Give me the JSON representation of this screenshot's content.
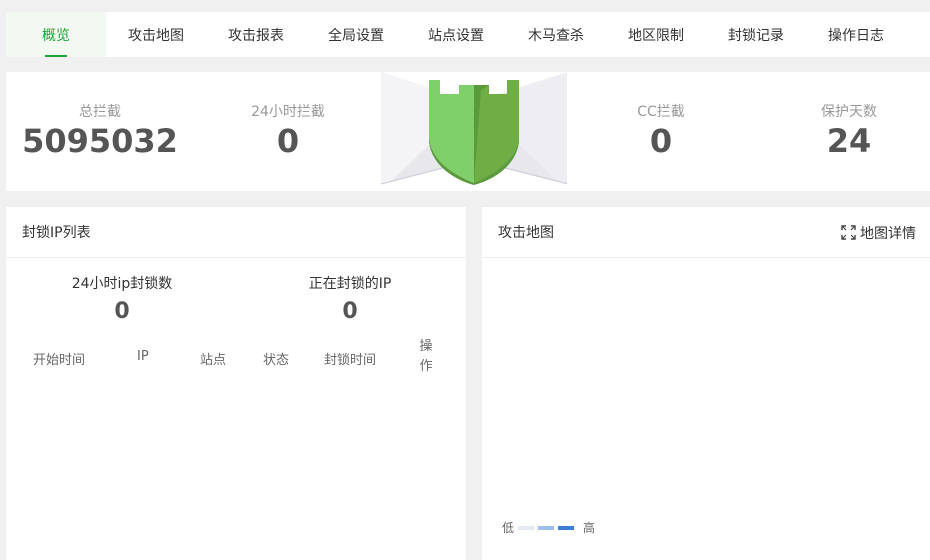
{
  "tabs": [
    {
      "label": "概览",
      "active": true
    },
    {
      "label": "攻击地图"
    },
    {
      "label": "攻击报表"
    },
    {
      "label": "全局设置"
    },
    {
      "label": "站点设置"
    },
    {
      "label": "木马查杀"
    },
    {
      "label": "地区限制"
    },
    {
      "label": "封锁记录"
    },
    {
      "label": "操作日志"
    }
  ],
  "stats": {
    "total": {
      "label": "总拦截",
      "value": "5095032"
    },
    "day": {
      "label": "24小时拦截",
      "value": "0"
    },
    "cc": {
      "label": "CC拦截",
      "value": "0"
    },
    "days": {
      "label": "保护天数",
      "value": "24"
    }
  },
  "ip_panel": {
    "title": "封锁IP列表",
    "count_24h": {
      "label": "24小时ip封锁数",
      "value": "0"
    },
    "count_now": {
      "label": "正在封锁的IP",
      "value": "0"
    },
    "columns": [
      "开始时间",
      "IP",
      "站点",
      "状态",
      "封锁时间",
      "操作"
    ]
  },
  "map_panel": {
    "title": "攻击地图",
    "detail_label": "地图详情",
    "legend_low": "低",
    "legend_high": "高",
    "legend_colors": [
      "#e3ebf7",
      "#9fbde9",
      "#3b7fd8"
    ]
  },
  "colors": {
    "accent": "#20a53a",
    "shield_light": "#7fd06b",
    "shield_dark": "#5a9a3a"
  }
}
